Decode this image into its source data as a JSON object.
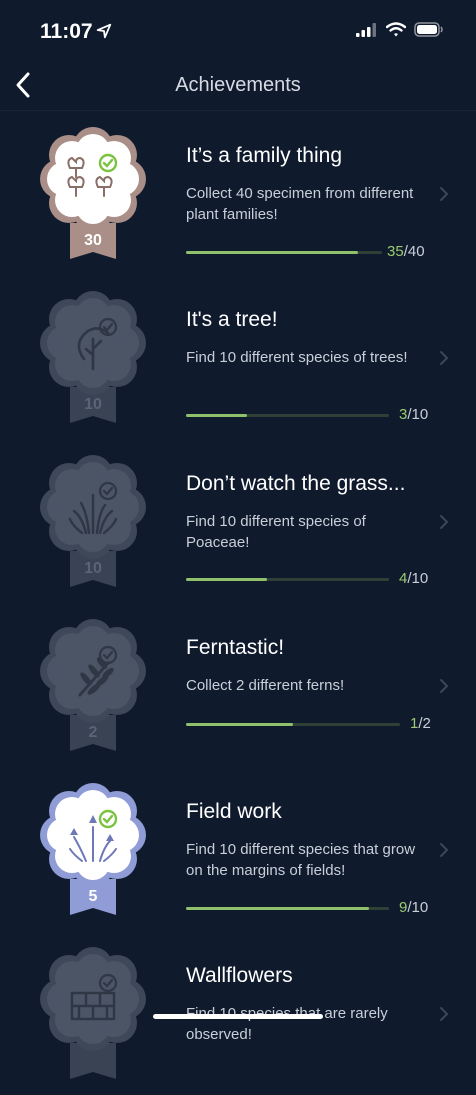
{
  "status": {
    "time": "11:07"
  },
  "nav": {
    "title": "Achievements"
  },
  "achievements": [
    {
      "title": "It’s a family thing",
      "description": "Collect 40 specimen from different plant families!",
      "level": "30",
      "current": "35",
      "total": "/40",
      "fraction": 0.875,
      "unlocked": true,
      "badge_icon": "flowers-icon",
      "badge_color": "#a98f88"
    },
    {
      "title": "It's a tree!",
      "description": "Find 10 different species of trees!",
      "level": "10",
      "current": "3",
      "total": "/10",
      "fraction": 0.3,
      "unlocked": false,
      "badge_icon": "tree-icon",
      "badge_color": "#4b5566"
    },
    {
      "title": "Don’t watch the grass...",
      "description": "Find 10 different species of Poaceae!",
      "level": "10",
      "current": "4",
      "total": "/10",
      "fraction": 0.4,
      "unlocked": false,
      "badge_icon": "grass-icon",
      "badge_color": "#4b5566"
    },
    {
      "title": "Ferntastic!",
      "description": "Collect 2 different ferns!",
      "level": "2",
      "current": "1",
      "total": "/2",
      "fraction": 0.5,
      "unlocked": false,
      "badge_icon": "fern-icon",
      "badge_color": "#4b5566"
    },
    {
      "title": "Field work",
      "description": "Find 10 different species that grow on the margins of fields!",
      "level": "5",
      "current": "9",
      "total": "/10",
      "fraction": 0.9,
      "unlocked": true,
      "badge_icon": "wildflowers-icon",
      "badge_color": "#8f9cd6"
    },
    {
      "title": "Wallflowers",
      "description": "Find 10 species that are rarely observed!",
      "level": "",
      "current": "",
      "total": "",
      "fraction": 0,
      "unlocked": false,
      "badge_icon": "wall-icon",
      "badge_color": "#4b5566"
    }
  ],
  "colors": {
    "background": "#0f1a2c",
    "progress_fill": "#8fc06b",
    "check_green": "#7cc241"
  }
}
